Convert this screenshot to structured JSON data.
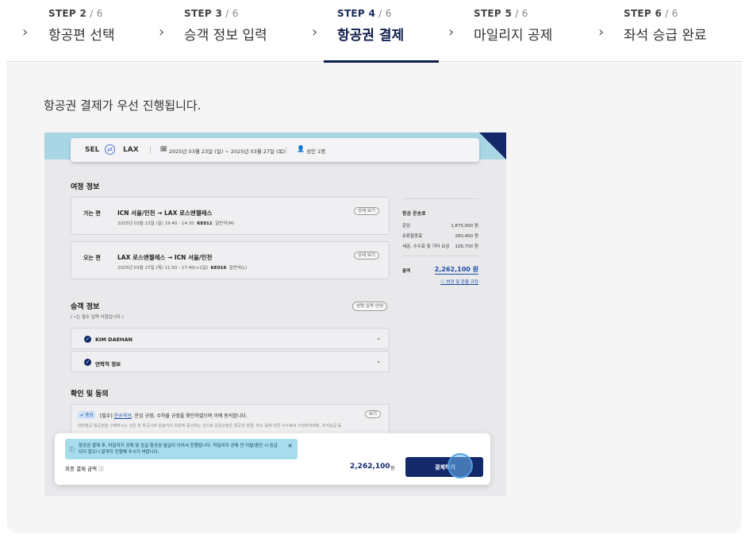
{
  "stepper": {
    "steps": [
      {
        "step": "STEP 2",
        "total": " / 6",
        "name": "항공편 선택"
      },
      {
        "step": "STEP 3",
        "total": " / 6",
        "name": "승객 정보 입력"
      },
      {
        "step": "STEP 4",
        "total": " / 6",
        "name": "항공권 결제"
      },
      {
        "step": "STEP 5",
        "total": " / 6",
        "name": "마일리지 공제"
      },
      {
        "step": "STEP 6",
        "total": " / 6",
        "name": "좌석 승급 완료"
      }
    ],
    "active_index": 2
  },
  "notice": "항공권 결제가 우선 진행됩니다.",
  "screenshot": {
    "search": {
      "from": "SEL",
      "to": "LAX",
      "dates": "2025년 03월 23일 (일) ~ 2025년 03월 27일 (목)",
      "passengers": "성인 1명"
    },
    "itinerary": {
      "title": "여정 정보",
      "outbound": {
        "label": "가는 편",
        "route": "ICN 서울/인천  →  LAX 로스앤젤레스",
        "detail_time": "2025년 03월 23일 (일) 19:40 - 14:30",
        "flight": "KE011",
        "class": "일반석(M)",
        "button": "상세 보기"
      },
      "inbound": {
        "label": "오는 편",
        "route": "LAX 로스앤젤레스  →  ICN 서울/인천",
        "detail_time": "2025년 03월 27일 (목) 11:50 - 17:40(+1일)",
        "flight": "KE018",
        "class": "일반석(L)",
        "button": "상세 보기"
      }
    },
    "fare": {
      "title": "항공 운송료",
      "rows": [
        {
          "label": "운임",
          "value": "1,875,000 원"
        },
        {
          "label": "유류할증료",
          "value": "260,400 원"
        },
        {
          "label": "세금, 수수료 및 기타 요금",
          "value": "126,700 원"
        }
      ],
      "total_label": "총액",
      "total_value": "2,262,100 원",
      "rules_link": "ⓘ 변경 및 환불 규정"
    },
    "passenger": {
      "title": "승객 정보",
      "required_note": "( •는 필수 입력 사항입니다.)",
      "name_button": "성명 입력 안내",
      "items": [
        "KIM DAEHAN",
        "연락처 정보"
      ]
    },
    "agreement": {
      "title": "확인 및 동의",
      "tag": "✔ 동의",
      "text_prefix": "[필수] ",
      "text_link": "운송약관",
      "text_suffix": ", 운임 규정, 수하물 규정을 확인하였으며 이에 동의합니다.",
      "view": "보기",
      "desc": "대한항공 항공권을 구매하시는 것은 본 항공사와 운송거리 회원에 동의하는 것으로 운임규정은 항공권 변경, 취소 등에 따른 수수료와 사전좌석배정, 좌석승급 등"
    },
    "paybar": {
      "toast": "항공권 결제 후, 마일리지 공제 및 승급 항공권 발급이 이어서 진행됩니다. 마일리지 공제 전 이탈/중단 시 승급되지 않으니 끝까지 진행해 주시기 바랍니다.",
      "total_label": "최종 결제 금액 ⓘ",
      "amount": "2,262,100",
      "currency": "원",
      "button": "결제하기"
    }
  },
  "colors": {
    "brand_navy": "#0e1e4e",
    "toast_bg": "#a7dcec",
    "link_blue": "#1b4fa8"
  }
}
